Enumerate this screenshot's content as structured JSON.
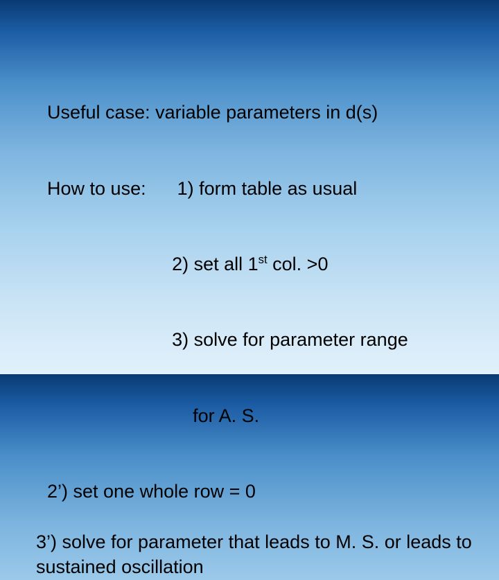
{
  "line1": "Useful case: variable parameters in d(s)",
  "howto_label": "How to use:      ",
  "steps_indent": "                        ",
  "step1": "1) form table as usual",
  "step2_pre": "2) set all 1",
  "step2_sup": "st",
  "step2_post": " col. >0",
  "step3a": "3) solve for parameter range",
  "step3b": "    for A. S.",
  "alt2": "2’) set one whole row = 0",
  "alt3": "3’) solve for parameter that leads to M. S. or leads to sustained oscillation"
}
